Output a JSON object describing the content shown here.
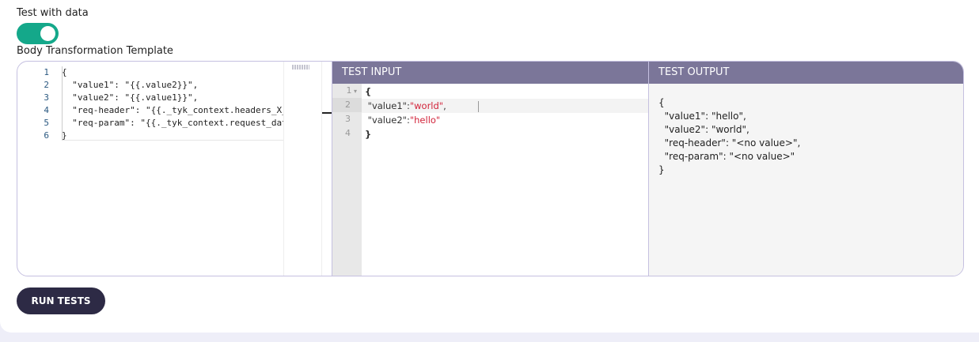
{
  "test_with_data": {
    "label": "Test with data",
    "enabled": true
  },
  "template": {
    "label": "Body Transformation Template",
    "line_numbers": [
      "1",
      "2",
      "3",
      "4",
      "5",
      "6"
    ],
    "lines": [
      "{",
      "  \"value1\": \"{{.value2}}\",",
      "  \"value2\": \"{{.value1}}\",",
      "  \"req-header\": \"{{._tyk_context.headers_X_",
      "  \"req-param\": \"{{._tyk_context.request_dat",
      "}"
    ]
  },
  "test_input": {
    "title": "TEST INPUT",
    "line_numbers": [
      "1",
      "2",
      "3",
      "4"
    ],
    "lines": [
      {
        "key": "{",
        "val": "",
        "tail": ""
      },
      {
        "key": " \"value1\":",
        "val": "\"world\"",
        "tail": ","
      },
      {
        "key": " \"value2\":",
        "val": "\"hello\"",
        "tail": ""
      },
      {
        "key": "}",
        "val": "",
        "tail": ""
      }
    ],
    "string_color": "#d2233a"
  },
  "test_output": {
    "title": "TEST OUTPUT",
    "text": "{\n  \"value1\": \"hello\",\n  \"value2\": \"world\",\n  \"req-header\": \"<no value>\",\n  \"req-param\": \"<no value>\"\n}"
  },
  "run_tests_label": "RUN TESTS",
  "colors": {
    "toggle": "#14a88a",
    "header": "#7b7699",
    "button": "#2d2a45"
  }
}
